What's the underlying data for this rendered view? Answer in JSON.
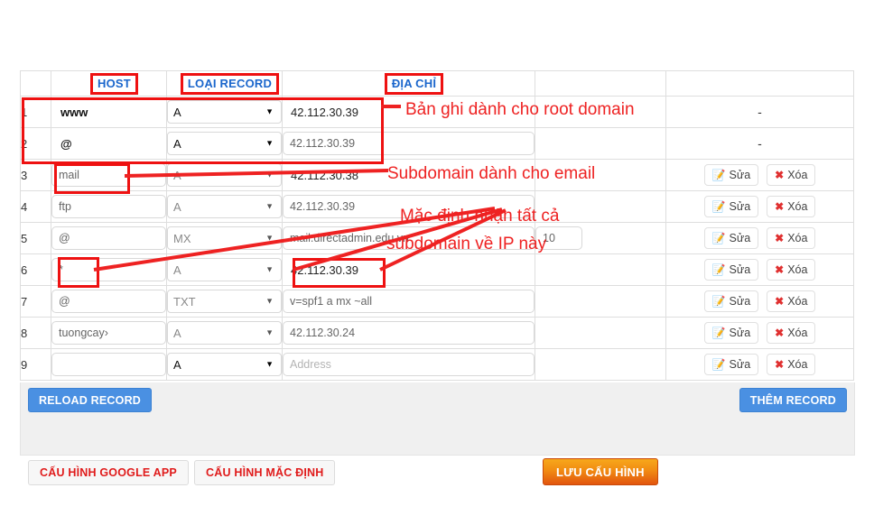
{
  "table": {
    "headers": {
      "num": "",
      "host": "HOST",
      "type": "LOẠI RECORD",
      "address": "ĐỊA CHỈ",
      "extra": "",
      "action": ""
    },
    "rows": [
      {
        "num": "1",
        "host": "www",
        "host_style": "bare",
        "type": "A",
        "type_enabled": true,
        "address": "42.112.30.39",
        "address_style": "plain",
        "extra": "",
        "action": "dash"
      },
      {
        "num": "2",
        "host": "@",
        "host_style": "bare",
        "type": "A",
        "type_enabled": true,
        "address": "42.112.30.39",
        "address_style": "open",
        "extra": "",
        "action": "dash"
      },
      {
        "num": "3",
        "host": "mail",
        "host_style": "input",
        "type": "A",
        "type_enabled": false,
        "address": "42.112.30.38",
        "address_style": "plain",
        "extra": "",
        "action": "buttons"
      },
      {
        "num": "4",
        "host": "ftp",
        "host_style": "input",
        "type": "A",
        "type_enabled": false,
        "address": "42.112.30.39",
        "address_style": "open",
        "extra": "",
        "action": "buttons"
      },
      {
        "num": "5",
        "host": "@",
        "host_style": "input",
        "type": "MX",
        "type_enabled": false,
        "address": "mail.directadmin.edu.vn",
        "address_style": "open",
        "extra": "10",
        "action": "buttons"
      },
      {
        "num": "6",
        "host": "*",
        "host_style": "input",
        "type": "A",
        "type_enabled": false,
        "address": "42.112.30.39",
        "address_style": "plain",
        "extra": "",
        "action": "buttons"
      },
      {
        "num": "7",
        "host": "@",
        "host_style": "input",
        "type": "TXT",
        "type_enabled": false,
        "address": "v=spf1 a mx ~all",
        "address_style": "open",
        "extra": "",
        "action": "buttons"
      },
      {
        "num": "8",
        "host": "tuongcay›",
        "host_style": "input",
        "type": "A",
        "type_enabled": false,
        "address": "42.112.30.24",
        "address_style": "open",
        "extra": "",
        "action": "buttons"
      },
      {
        "num": "9",
        "host": "",
        "host_style": "input",
        "type": "A",
        "type_enabled": true,
        "address": "",
        "address_style": "open",
        "extra": "",
        "action": "buttons"
      }
    ],
    "row_action": {
      "edit_label": "Sửa",
      "delete_label": "Xóa",
      "edit_icon": "pencil-note-icon",
      "delete_icon": "red-x-icon",
      "no_action_label": "-"
    },
    "placeholders": {
      "host": "",
      "address": "Address"
    }
  },
  "footer": {
    "reload_record": "RELOAD RECORD",
    "them_record": "THÊM RECORD",
    "cau_hinh_google_app": "CẤU HÌNH GOOGLE APP",
    "cau_hinh_mac_dinh": "CẤU HÌNH MẶC ĐỊNH",
    "luu_cau_hinh": "LƯU CẤU HÌNH"
  },
  "annotations": {
    "root_domain": "Bản ghi dành cho root domain",
    "email_subdomain": "Subdomain dành cho email",
    "wildcard_line1": "Mặc định nhận tất cả",
    "wildcard_line2": "subdomain về IP này"
  },
  "colors": {
    "annotation_red": "#ee2222",
    "header_blue": "#1a66cc",
    "button_blue": "#4a90e2",
    "button_orange": "#f18b12",
    "button_red_text": "#e01b1b"
  }
}
